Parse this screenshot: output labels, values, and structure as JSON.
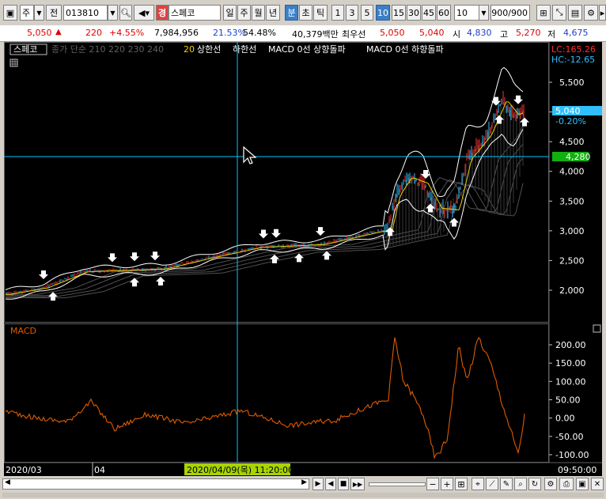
{
  "toolbar": {
    "market": "주",
    "market_type": "전",
    "code": "013810",
    "badge": "경",
    "stock_name": "스페코",
    "periods": [
      "일",
      "주",
      "월",
      "년"
    ],
    "active_period": "분",
    "period_extra": [
      "초",
      "틱"
    ],
    "intervals": [
      "1",
      "3",
      "5",
      "10",
      "15",
      "30",
      "45",
      "60"
    ],
    "active_interval": "10",
    "interval_select": "10",
    "count": "900/900"
  },
  "quote": {
    "price": "5,050",
    "change": "220",
    "change_pct": "+4.55%",
    "volume": "7,984,956",
    "turnover_pct": "21.53%",
    "ratio": "54.48%",
    "amount": "40,379백만",
    "best_label": "최우선",
    "ask": "5,050",
    "bid": "5,040",
    "open_label": "시",
    "open": "4,830",
    "high_label": "고",
    "high": "5,270",
    "low_label": "저",
    "low": "4,675"
  },
  "price_panel": {
    "name_tag": "스페코",
    "legend": [
      {
        "text": "종가 단순 210 220 230 240",
        "color": "#606060"
      },
      {
        "text": "20",
        "color": "#f0d000"
      },
      {
        "text": "상한선",
        "color": "#ffffff"
      },
      {
        "text": "하한선",
        "color": "#ffffff"
      },
      {
        "text": "MACD 0선 상향돌파",
        "color": "#ffffff"
      },
      {
        "text": "MACD 0선 하향돌파",
        "color": "#ffffff"
      }
    ],
    "lc": "LC:165.26",
    "hc": "HC:-12.65",
    "price_ticks": [
      {
        "label": "5,500",
        "v": 5500
      },
      {
        "label": "5,000",
        "v": 5000
      },
      {
        "label": "4,500",
        "v": 4500
      },
      {
        "label": "4,000",
        "v": 4000
      },
      {
        "label": "3,500",
        "v": 3500
      },
      {
        "label": "3,000",
        "v": 3000
      },
      {
        "label": "2,500",
        "v": 2500
      },
      {
        "label": "2,000",
        "v": 2000
      }
    ],
    "last_price_label": "5,040",
    "last_change_label": "-0.20%",
    "crosshair_label": "4,280"
  },
  "macd_panel": {
    "title": "MACD",
    "ticks": [
      {
        "label": "200.00",
        "v": 200
      },
      {
        "label": "150.00",
        "v": 150
      },
      {
        "label": "100.00",
        "v": 100
      },
      {
        "label": "50.00",
        "v": 50
      },
      {
        "label": "0.00",
        "v": 0
      },
      {
        "label": "-50.00",
        "v": -50
      },
      {
        "label": "-100.00",
        "v": -100
      }
    ]
  },
  "time_axis": {
    "start_label": "2020/03",
    "month_label": "04",
    "crosshair_label": "2020/04/09(목) 11:20:00",
    "end_label": "09:50:00"
  },
  "colors": {
    "up": "#ff3030",
    "down": "#30c0ff",
    "ma20": "#f0d000",
    "band": "#ffffff",
    "macd": "#e05a00",
    "crosshair": "#00c8ff"
  }
}
